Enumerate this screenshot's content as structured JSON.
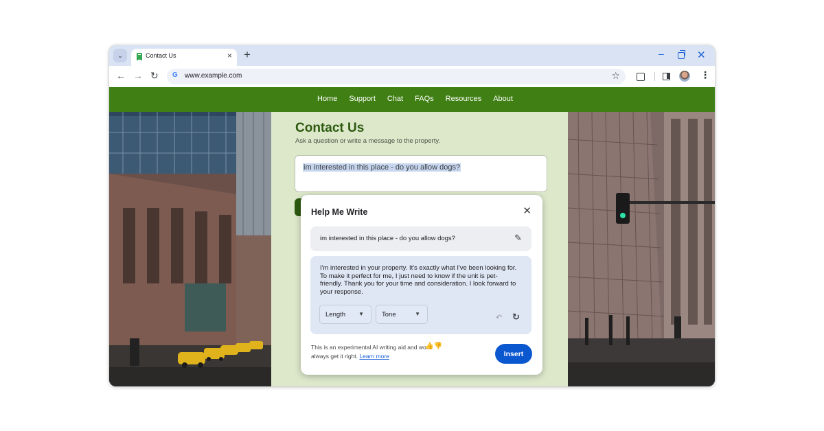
{
  "browser": {
    "tab_title": "Contact Us",
    "tab_close": "×",
    "new_tab": "+",
    "url": "www.example.com",
    "icons": [
      "tab-search-icon",
      "back-icon",
      "forward-icon",
      "reload-icon",
      "google-icon",
      "star-icon",
      "extensions-icon",
      "side-panel-icon",
      "profile-avatar",
      "more-menu-icon",
      "minimize-icon",
      "maximize-icon",
      "close-window-icon"
    ]
  },
  "site": {
    "nav": [
      "Home",
      "Support",
      "Chat",
      "FAQs",
      "Resources",
      "About"
    ],
    "title": "Contact Us",
    "subtitle": "Ask a question or write a message to the property.",
    "message": "im interested in this place - do you allow dogs?"
  },
  "help_me_write": {
    "title": "Help Me Write",
    "prompt": "im interested in this place - do you allow dogs?",
    "result": "I'm interested in your property. It's exactly what I've been looking for. To make it perfect for me, I just need to know if the unit is pet-friendly. Thank you for your time and consideration. I look forward to your response.",
    "length_label": "Length",
    "tone_label": "Tone",
    "disclaimer_text": "This is an experimental AI writing aid and won't always get it right.",
    "learn_more": "Learn more",
    "insert_label": "Insert"
  },
  "colors": {
    "site_green": "#3f7f13",
    "page_bg": "#dde8cb",
    "insert_blue": "#0b57d0",
    "title_green": "#2d5a0f"
  }
}
